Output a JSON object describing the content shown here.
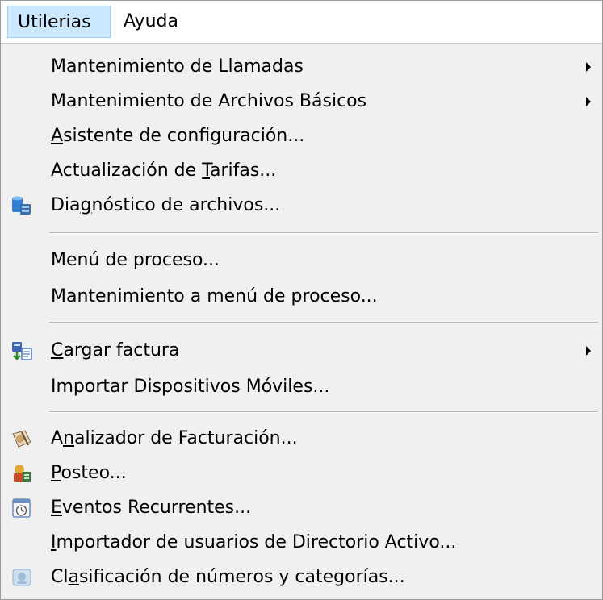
{
  "menubar": {
    "utilerias": "Utilerias",
    "ayuda": "Ayuda"
  },
  "menu": {
    "mantenimiento_llamadas": "Mantenimiento de Llamadas",
    "mantenimiento_archivos": "Mantenimiento de Archivos Básicos",
    "asistente": {
      "pre": "",
      "ul": "A",
      "post": "sistente de configuración..."
    },
    "actualizacion": {
      "pre": "Actualización de ",
      "ul": "T",
      "post": "arifas..."
    },
    "diagnostico": {
      "pre": "Dia",
      "ul": "g",
      "post": "nóstico de archivos..."
    },
    "menu_proceso": "Menú de proceso...",
    "mantenimiento_menu": "Mantenimiento a menú de proceso...",
    "cargar_factura": {
      "pre": "",
      "ul": "C",
      "post": "argar factura"
    },
    "importar_dispositivos": "Importar Dispositivos Móviles...",
    "analizador": {
      "pre": "A",
      "ul": "n",
      "post": "alizador de Facturación..."
    },
    "posteo": {
      "pre": "",
      "ul": "P",
      "post": "osteo..."
    },
    "eventos": {
      "pre": "",
      "ul": "E",
      "post": "ventos Recurrentes..."
    },
    "importador": {
      "pre": "",
      "ul": "I",
      "post": "mportador de usuarios de Directorio Activo..."
    },
    "clasificacion": {
      "pre": "Cl",
      "ul": "a",
      "post": "sificación de números y categorías..."
    }
  },
  "icons": {
    "diagnostico": "database-diagnostic-icon",
    "cargar_factura": "load-invoice-icon",
    "analizador": "analyzer-icon",
    "posteo": "posting-icon",
    "eventos": "calendar-clock-icon",
    "clasificacion": "classification-icon"
  },
  "colors": {
    "menubar_active_bg": "#cce8ff",
    "menubar_active_border": "#99d1ff",
    "menu_bg": "#f0f0f0"
  }
}
